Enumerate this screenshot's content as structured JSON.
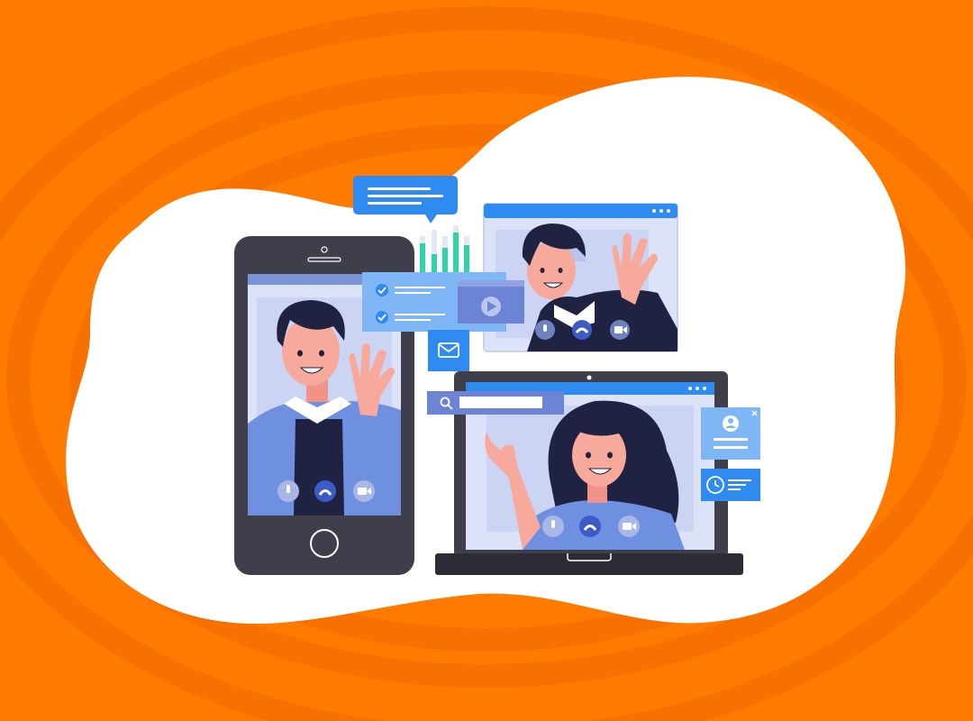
{
  "colors": {
    "background": "#FF7A00",
    "background_swirl": "#F46A00",
    "blob": "#FFFFFF",
    "device_dark": "#3E3F4A",
    "device_darker": "#2B2C36",
    "screen_bg": "#DCE3F8",
    "ui_blue": "#2F8BF0",
    "ui_light_blue": "#7FB6F5",
    "shirt_blue": "#6F8FE0",
    "skin": "#F7A99B",
    "hair": "#1F2240",
    "accent_green": "#2DD4A8",
    "call_button": "#3D5BC4"
  },
  "phone": {
    "caller": "man-waving",
    "call_controls": [
      "microphone-icon",
      "end-call-icon",
      "camera-icon"
    ]
  },
  "laptop": {
    "caller": "woman-pointing",
    "call_controls": [
      "microphone-icon",
      "end-call-icon",
      "camera-icon"
    ],
    "search_bar": "search-icon"
  },
  "desktop_window": {
    "caller": "man-waving",
    "call_controls": [
      "microphone-icon",
      "end-call-icon",
      "camera-icon"
    ]
  },
  "floating_widgets": [
    "chat-bubble",
    "checklist-card",
    "video-player-card",
    "mail-icon",
    "profile-card",
    "clock-card",
    "bar-chart"
  ]
}
